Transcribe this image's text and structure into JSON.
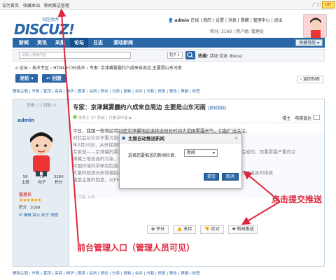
{
  "topbar": {
    "set_home": "设为首页",
    "bookmark": "收藏本站",
    "news": "新闻推送管理",
    "diy": "DIY"
  },
  "logo": {
    "sub": "社区动力",
    "brand": "DISCUZ!"
  },
  "user": {
    "name": "admin",
    "online": "在线",
    "links": [
      "我的",
      "设置",
      "消息",
      "提醒",
      "管理中心",
      "退出"
    ],
    "credits": "积分: 3160",
    "group": "用户组: 管理员"
  },
  "nav": {
    "items": [
      "新闻",
      "资讯",
      "采集",
      "论坛",
      "日志",
      "滚动新闻"
    ],
    "quick": "快捷导航"
  },
  "search": {
    "placeholder": "请输入搜索内容",
    "type": "帖子",
    "hot_label": "热搜:",
    "hot": [
      "活动",
      "交友",
      "discuz"
    ]
  },
  "breadcrumb": "论坛 › 技术专区 › HTML+CSS技术 › 专家: 京津冀雾霾约六成来自周边 主要是山东河南",
  "buttons": {
    "post": "发帖",
    "reply": "回复",
    "back": "返回列表"
  },
  "modbar": [
    "删除主题",
    "升降",
    "置顶",
    "高亮",
    "精华",
    "图章",
    "关闭",
    "移动",
    "分类",
    "复制",
    "合并",
    "分割",
    "修复",
    "警告",
    "屏蔽",
    "标签"
  ],
  "sidebar": {
    "stat": "查看: 1 | 回复: 0",
    "username": "admin",
    "stats": [
      {
        "v": "56",
        "l": "主题"
      },
      {
        "v": "70",
        "l": "帖子"
      },
      {
        "v": "3160",
        "l": "积分"
      }
    ],
    "group": "管理员",
    "credits_label": "积分",
    "credits_value": "3160",
    "links": "IP 编辑 禁止 帖子 清理"
  },
  "post": {
    "title": "专家：京津冀雾霾约六成来自周边 主要是山东河南",
    "copy": "[复制链接]",
    "info": "发表于 37 秒前 | 只看该作者 ▶",
    "floor": "楼主",
    "electric": "电梯直达",
    "body": [
      "今日，我国一些地区特别是京津冀地区连续出现长时间大范围雾霾天气，引起广泛关注，",
      "对社会公众对于重污染天气有了更多认识，也有更多期待。",
      "年2月20日，从环保部获悉，",
      "专家说——京津冀的雾霾是京津冀及周边区域共同污染源叠加的结果，区域重污染源造成的，而重雾霾严重的京",
      "津冀三地自身的污染，约四成来自内部，另外约六成来自周边区域的输送。",
      "中国环境科学研究院柴发合研究员说，这种",
      "大量的观测分析和模拟研究发现，京津冀地区的雾霾约六成来自周边，其中，京津冀三地自身的排放",
      "量是主要的因素，对PM2.5的贡献率达约四成左右。"
    ],
    "location": "河南, 山东",
    "actions": [
      "评分",
      "支持",
      "反对",
      "新闻推送"
    ]
  },
  "dialog": {
    "title": "主题自动推送新闻",
    "label": "选择您要推送的新闻栏目:",
    "select": "新闻",
    "submit": "提交",
    "cancel": "取消",
    "close": "×"
  },
  "annotations": {
    "admin_entry": "前台管理入口（管理人员可见）",
    "submit_hint": "点击提交推送"
  },
  "colors": {
    "brand": "#2a67a7",
    "annotation": "#e0243a"
  }
}
